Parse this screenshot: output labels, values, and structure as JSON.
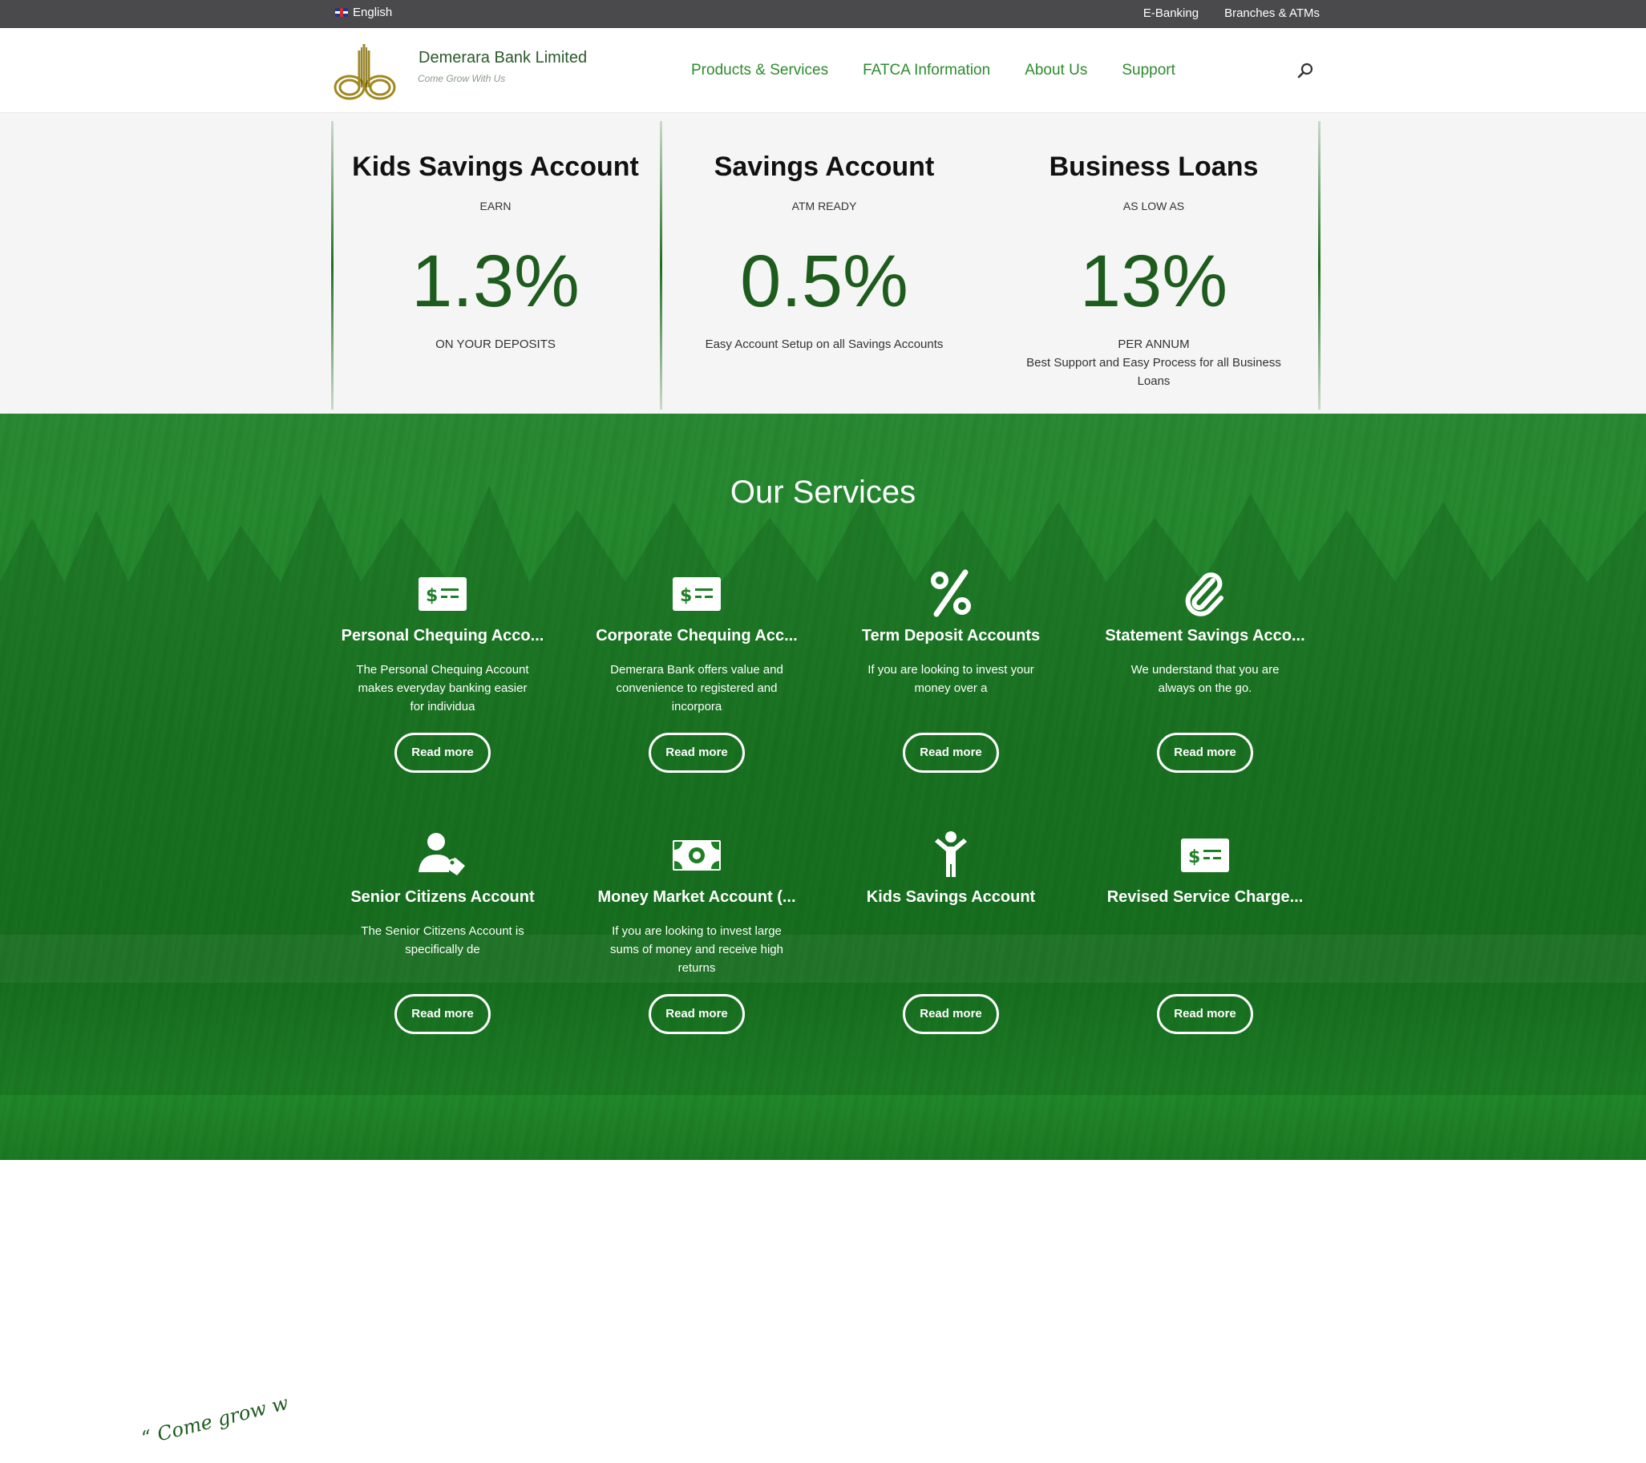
{
  "topbar": {
    "language": "English",
    "links": [
      "E-Banking",
      "Branches & ATMs"
    ]
  },
  "header": {
    "brand_name": "Demerara Bank Limited",
    "brand_tagline": "Come Grow With Us",
    "nav": [
      "Products & Services",
      "FATCA Information",
      "About Us",
      "Support"
    ],
    "search_icon": "search-icon"
  },
  "rates": [
    {
      "title": "Kids Savings Account",
      "subtitle": "EARN",
      "rate": "1.3%",
      "footer": "ON YOUR DEPOSITS"
    },
    {
      "title": "Savings Account",
      "subtitle": "ATM READY",
      "rate": "0.5%",
      "footer": "Easy Account Setup on all Savings Accounts"
    },
    {
      "title": "Business Loans",
      "subtitle": "AS LOW AS",
      "rate": "13%",
      "footer": "PER ANNUM\nBest Support and Easy Process for all Business Loans"
    }
  ],
  "services": {
    "title": "Our Services",
    "items": [
      {
        "title": "Personal Chequing Acco...",
        "desc": "The Personal Chequing Account makes everyday banking easier for individua",
        "button": "Read more",
        "icon": "money-check-icon"
      },
      {
        "title": "Corporate Chequing Acc...",
        "desc": "Demerara Bank offers value and convenience to registered and incorpora",
        "button": "Read more",
        "icon": "money-check-icon"
      },
      {
        "title": "Term Deposit Accounts",
        "desc": "If you are looking to invest your money over a",
        "button": "Read more",
        "icon": "percent-icon"
      },
      {
        "title": "Statement Savings Acco...",
        "desc": "We understand that you are always on the go.",
        "button": "Read more",
        "icon": "paperclip-icon"
      },
      {
        "title": "Senior Citizens Account",
        "desc": "The Senior Citizens Account is specifically de",
        "button": "Read more",
        "icon": "user-tag-icon"
      },
      {
        "title": "Money Market Account (...",
        "desc": "If you are looking to invest large sums of money and receive high returns",
        "button": "Read more",
        "icon": "money-bill-icon"
      },
      {
        "title": "Kids Savings Account",
        "desc": "",
        "button": "Read more",
        "icon": "child-icon"
      },
      {
        "title": "Revised Service Charge...",
        "desc": "",
        "button": "Read more",
        "icon": "money-check-icon"
      }
    ]
  },
  "footer": {
    "slogan": "“ Come grow with us ”"
  },
  "colors": {
    "brand_green": "#1e5c1e",
    "nav_green": "#2e8b2e",
    "services_bg": "#228a2c",
    "topbar_bg": "#4a4a4c"
  }
}
